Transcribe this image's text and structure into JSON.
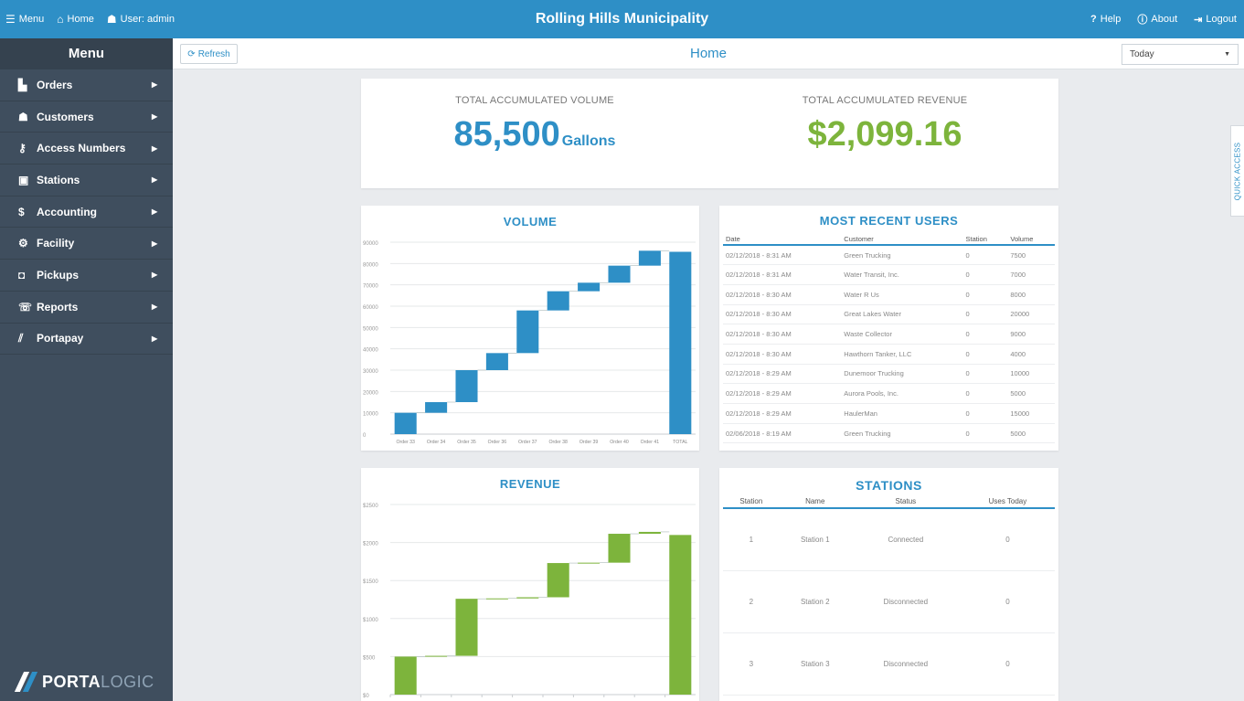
{
  "topbar": {
    "menu_label": "Menu",
    "home_label": "Home",
    "user_label": "User: admin",
    "title": "Rolling Hills Municipality",
    "help_label": "Help",
    "about_label": "About",
    "logout_label": "Logout"
  },
  "sidebar": {
    "title": "Menu",
    "items": [
      {
        "label": "Orders",
        "icon": "orders-icon",
        "glyph": "▙"
      },
      {
        "label": "Customers",
        "icon": "user-icon",
        "glyph": "☗"
      },
      {
        "label": "Access Numbers",
        "icon": "key-icon",
        "glyph": "⚷"
      },
      {
        "label": "Stations",
        "icon": "station-icon",
        "glyph": "▣"
      },
      {
        "label": "Accounting",
        "icon": "dollar-icon",
        "glyph": "$"
      },
      {
        "label": "Facility",
        "icon": "gears-icon",
        "glyph": "⚙"
      },
      {
        "label": "Pickups",
        "icon": "inbox-icon",
        "glyph": "◘"
      },
      {
        "label": "Reports",
        "icon": "reports-icon",
        "glyph": "☏"
      },
      {
        "label": "Portapay",
        "icon": "portapay-icon",
        "glyph": "⫽"
      }
    ],
    "logo": {
      "brand_bold": "PORTA",
      "brand_thin": "LOGIC"
    }
  },
  "header": {
    "refresh_label": "Refresh",
    "page_title": "Home",
    "range_value": "Today"
  },
  "quick_access_label": "QUICK ACCESS",
  "totals": {
    "volume_label": "TOTAL ACCUMULATED VOLUME",
    "volume_value": "85,500",
    "volume_unit": "Gallons",
    "revenue_label": "TOTAL ACCUMULATED REVENUE",
    "revenue_value": "$2,099.16"
  },
  "colors": {
    "accent": "#2e8fc6",
    "revenue": "#7db43c",
    "sidebar": "#3f4e5e"
  },
  "volume_chart": {
    "title": "VOLUME",
    "chart_data": {
      "type": "bar",
      "subtype": "waterfall",
      "categories": [
        "Order 33",
        "Order 34",
        "Order 35",
        "Order 36",
        "Order 37",
        "Order 38",
        "Order 39",
        "Order 40",
        "Order 41",
        "TOTAL"
      ],
      "values": [
        10000,
        5000,
        15000,
        8000,
        20000,
        9000,
        4000,
        8000,
        7000,
        85500
      ],
      "ylim": [
        0,
        90000
      ],
      "yticks": [
        0,
        10000,
        20000,
        30000,
        40000,
        50000,
        60000,
        70000,
        80000,
        90000
      ],
      "grid": true
    }
  },
  "revenue_chart": {
    "title": "REVENUE",
    "chart_data": {
      "type": "bar",
      "subtype": "waterfall",
      "values": [
        500,
        10,
        750,
        5,
        15,
        450,
        5,
        380,
        25,
        2099.16
      ],
      "ylim": [
        0,
        2500
      ],
      "yticks": [
        0,
        500,
        1000,
        1500,
        2000,
        2500
      ],
      "ytick_labels": [
        "$0",
        "$500",
        "$1000",
        "$1500",
        "$2000",
        "$2500"
      ],
      "grid": true
    }
  },
  "users": {
    "title": "MOST RECENT USERS",
    "headers": [
      "Date",
      "Customer",
      "Station",
      "Volume"
    ],
    "rows": [
      [
        "02/12/2018 - 8:31 AM",
        "Green Trucking",
        "0",
        "7500"
      ],
      [
        "02/12/2018 - 8:31 AM",
        "Water Transit, Inc.",
        "0",
        "7000"
      ],
      [
        "02/12/2018 - 8:30 AM",
        "Water R Us",
        "0",
        "8000"
      ],
      [
        "02/12/2018 - 8:30 AM",
        "Great Lakes Water",
        "0",
        "20000"
      ],
      [
        "02/12/2018 - 8:30 AM",
        "Waste Collector",
        "0",
        "9000"
      ],
      [
        "02/12/2018 - 8:30 AM",
        "Hawthorn Tanker, LLC",
        "0",
        "4000"
      ],
      [
        "02/12/2018 - 8:29 AM",
        "Dunemoor Trucking",
        "0",
        "10000"
      ],
      [
        "02/12/2018 - 8:29 AM",
        "Aurora Pools, Inc.",
        "0",
        "5000"
      ],
      [
        "02/12/2018 - 8:29 AM",
        "HaulerMan",
        "0",
        "15000"
      ],
      [
        "02/06/2018 - 8:19 AM",
        "Green Trucking",
        "0",
        "5000"
      ]
    ]
  },
  "stations": {
    "title": "STATIONS",
    "headers": [
      "Station",
      "Name",
      "Status",
      "Uses Today"
    ],
    "rows": [
      [
        "1",
        "Station 1",
        "Connected",
        "0"
      ],
      [
        "2",
        "Station 2",
        "Disconnected",
        "0"
      ],
      [
        "3",
        "Station 3",
        "Disconnected",
        "0"
      ]
    ]
  }
}
